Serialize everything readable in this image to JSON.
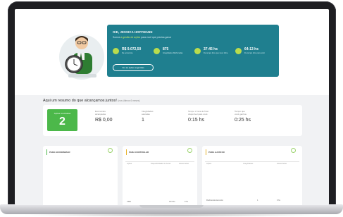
{
  "profile": {
    "title": "OIE, JESSICA HOFFMANN",
    "subtitle_prefix": "Somos",
    "subtitle_highlight": "a gestão de ações",
    "subtitle_suffix": "para você que precisa ganar",
    "button_label": "Ver as ações sugeridas"
  },
  "metrics": [
    {
      "value": "R$ 9.072,50",
      "label": "De economia",
      "icon": "money-icon"
    },
    {
      "value": "875",
      "label": "Integridades Melhoradas",
      "icon": "integrity-icon"
    },
    {
      "value": "37:45 hs",
      "label": "De tempo livre que voce tinha",
      "icon": "clock-icon"
    },
    {
      "value": "64:13 hs",
      "label": "De tempo livre para você",
      "icon": "clock-icon"
    }
  ],
  "summary": {
    "title": "Aqui um resumo do que alcançamos juntos!",
    "period": "(nos últimos 6 meses)",
    "done_label": "Ações concluídas",
    "done_value": "2",
    "stats": [
      {
        "label": "Economias\nalcançadas",
        "value": "R$ 0,00"
      },
      {
        "label": "Integridades\nsalvadas",
        "value": "1"
      },
      {
        "label": "Tempo x hora de froto\ndisponível para você",
        "value": "0:15 hs"
      },
      {
        "label": "Tempo que\nvocê ganhou",
        "value": "0:25 hs"
      }
    ]
  },
  "panels": [
    {
      "title": "PARA ECONOMIZAR",
      "accent": "#4cb84a",
      "columns": [],
      "rows": []
    },
    {
      "title": "PARA CONTROLAR",
      "accent": "#e7b32a",
      "columns": [
        "Ações",
        "Disponibilidade de horas",
        "Horas farias"
      ],
      "rows": [
        {
          "name": "CMH",
          "a": "0:15 hs",
          "b": "0 hs"
        }
      ]
    },
    {
      "title": "PARA AJUSTAR",
      "accent": "#e7b32a",
      "columns": [
        "Ações",
        "Integridades",
        "Horas farias"
      ],
      "rows": [
        {
          "name": "Redimensionamento",
          "a": "1",
          "b": "0 hs"
        }
      ]
    }
  ],
  "colors": {
    "primary": "#1f7f8f",
    "accent_green": "#4cb84a",
    "icon_lime": "#b9dc4d"
  }
}
